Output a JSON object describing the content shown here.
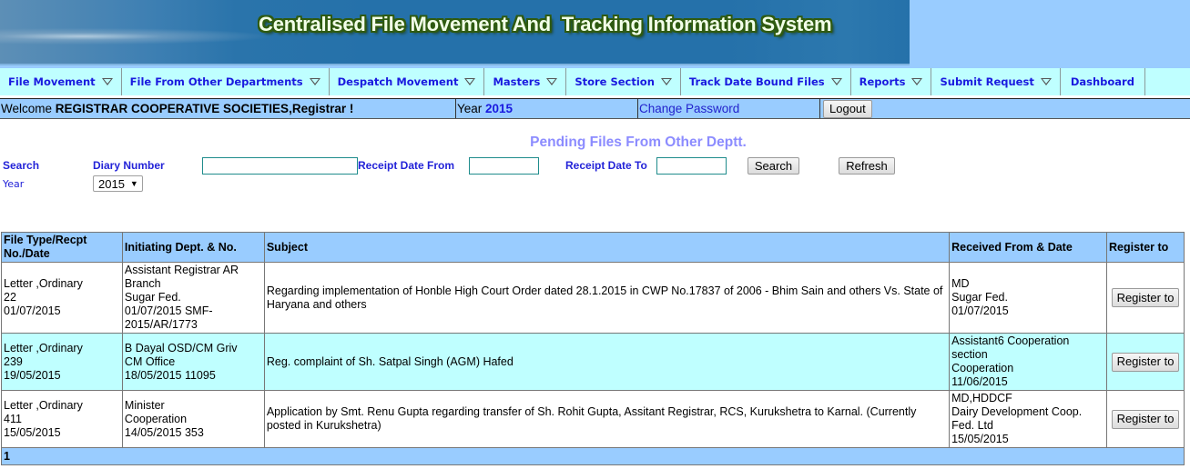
{
  "header": {
    "title": "Centralised File Movement And  Tracking Information System"
  },
  "menu": [
    {
      "label": "File Movement",
      "dropdown": true
    },
    {
      "label": "File From Other Departments",
      "dropdown": true
    },
    {
      "label": "Despatch Movement",
      "dropdown": true
    },
    {
      "label": "Masters",
      "dropdown": true
    },
    {
      "label": "Store Section",
      "dropdown": true
    },
    {
      "label": "Track Date Bound Files",
      "dropdown": true
    },
    {
      "label": "Reports",
      "dropdown": true
    },
    {
      "label": "Submit Request",
      "dropdown": true
    },
    {
      "label": "Dashboard",
      "dropdown": false
    }
  ],
  "welcome_bar": {
    "welcome_prefix": "Welcome ",
    "user": "REGISTRAR COOPERATIVE SOCIETIES,Registrar !",
    "year_label": "Year ",
    "year_value": "2015",
    "change_password": "Change Password",
    "logout": "Logout"
  },
  "page_title": "Pending Files From Other Deptt.",
  "search": {
    "search_label": "Search",
    "year_label": "Year",
    "diary_number_label": "Diary Number",
    "diary_number_value": "",
    "receipt_from_label": "Receipt Date From",
    "receipt_from_value": "",
    "receipt_to_label": "Receipt Date To",
    "receipt_to_value": "",
    "year_selected": "2015",
    "search_button": "Search",
    "refresh_button": "Refresh"
  },
  "table": {
    "headers": [
      "File Type/Recpt No./Date",
      "Initiating Dept. & No.",
      "Subject",
      "Received From & Date",
      "Register to"
    ],
    "rows": [
      {
        "file_type": [
          "Letter ,Ordinary",
          "22",
          "01/07/2015"
        ],
        "initiating": [
          "Assistant Registrar AR Branch",
          "Sugar Fed.",
          "01/07/2015 SMF-2015/AR/1773"
        ],
        "subject": "Regarding implementation of Honble High Court Order dated 28.1.2015 in CWP No.17837 of 2006 - Bhim Sain and others Vs. State of Haryana and others",
        "received": [
          "MD",
          "Sugar Fed.",
          "01/07/2015"
        ],
        "button": "Register to"
      },
      {
        "file_type": [
          "Letter ,Ordinary",
          "239",
          "19/05/2015"
        ],
        "initiating": [
          "B Dayal OSD/CM Griv",
          "CM Office",
          "18/05/2015 11095"
        ],
        "subject": "Reg. complaint of Sh. Satpal Singh (AGM) Hafed",
        "received": [
          "Assistant6 Cooperation section",
          "Cooperation",
          "11/06/2015"
        ],
        "button": "Register to"
      },
      {
        "file_type": [
          "Letter ,Ordinary",
          "411",
          "15/05/2015"
        ],
        "initiating": [
          "Minister",
          "Cooperation",
          "14/05/2015 353"
        ],
        "subject": "Application by Smt. Renu Gupta regarding transfer of Sh. Rohit Gupta, Assitant Registrar, RCS, Kurukshetra to Karnal. (Currently posted in Kurukshetra)",
        "received": [
          "MD,HDDCF",
          "Dairy Development Coop. Fed. Ltd",
          "15/05/2015"
        ],
        "button": "Register to"
      }
    ],
    "pager": "1"
  }
}
